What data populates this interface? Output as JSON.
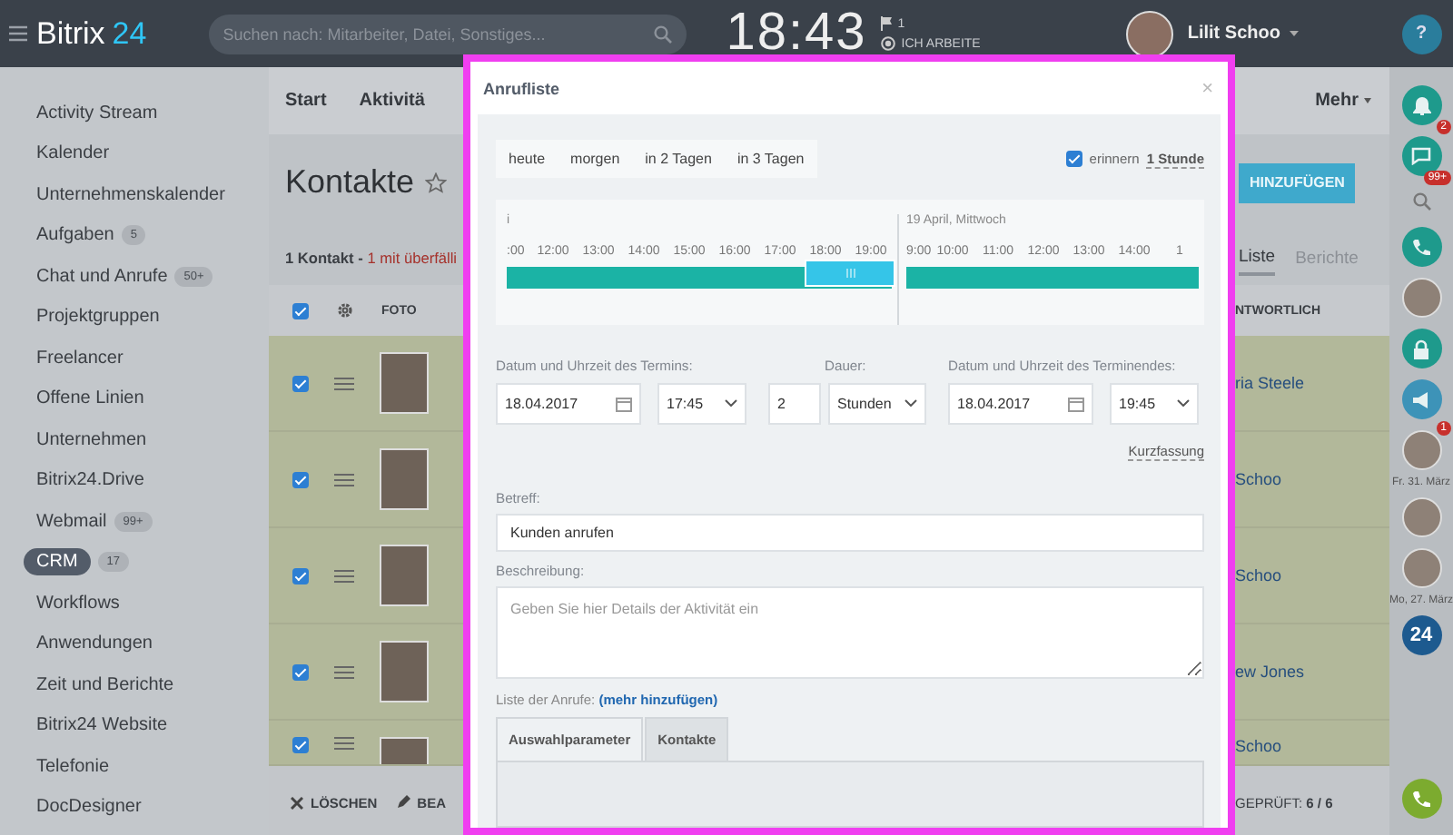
{
  "header": {
    "logo_name": "Bitrix",
    "logo_number": "24",
    "search": {
      "placeholder": "Suchen nach: Mitarbeiter, Datei, Sonstiges..."
    },
    "clock": "18:43",
    "flag_count": "1",
    "work_status": "ICH ARBEITE",
    "user_name": "Lilit Schoo"
  },
  "sidebar": {
    "items": [
      {
        "label": "Activity Stream",
        "selected": false
      },
      {
        "label": "Kalender",
        "selected": false
      },
      {
        "label": "Unternehmenskalender",
        "selected": false
      },
      {
        "label": "Aufgaben",
        "counter": "5",
        "selected": false
      },
      {
        "label": "Chat und Anrufe",
        "counter": "50+",
        "selected": false
      },
      {
        "label": "Projektgruppen",
        "selected": false
      },
      {
        "label": "Freelancer",
        "selected": false
      },
      {
        "label": "Offene Linien",
        "selected": false
      },
      {
        "label": "Unternehmen",
        "selected": false
      },
      {
        "label": "Bitrix24.Drive",
        "selected": false
      },
      {
        "label": "Webmail",
        "counter": "99+",
        "selected": false
      },
      {
        "label": "CRM",
        "counter": "17",
        "selected": true
      },
      {
        "label": "Workflows",
        "selected": false
      },
      {
        "label": "Anwendungen",
        "selected": false
      },
      {
        "label": "Zeit und Berichte",
        "selected": false
      },
      {
        "label": "Bitrix24 Website",
        "selected": false
      },
      {
        "label": "Telefonie",
        "selected": false
      },
      {
        "label": "DocDesigner",
        "selected": false
      }
    ]
  },
  "main": {
    "toolbar_tabs": [
      "Start",
      "Aktivitä"
    ],
    "more_menu": "Mehr",
    "title": "Kontakte",
    "add_button": "HINZUFÜGEN",
    "summary": "1 Kontakt - ",
    "overdue": "1 mit überfälli",
    "view_tabs": [
      {
        "label": "Liste",
        "selected": true
      },
      {
        "label": "Berichte",
        "selected": false
      }
    ],
    "select_all": {
      "checked": true
    },
    "columns": [
      "FOTO",
      "NTWORTLICH"
    ],
    "rows": [
      {
        "checked": true,
        "responsible": "ria Steele"
      },
      {
        "checked": true,
        "responsible": "Schoo"
      },
      {
        "checked": true,
        "responsible": "Schoo"
      },
      {
        "checked": true,
        "responsible": "ew Jones"
      },
      {
        "checked": true,
        "responsible": "Schoo"
      }
    ],
    "footer_actions": [
      "LÖSCHEN",
      "BEA"
    ],
    "checked_summary": "GEPRÜFT: ",
    "checked_count": "6 / 6"
  },
  "rail": {
    "items": [
      {
        "kind": "help",
        "text": "?"
      },
      {
        "kind": "bell",
        "badge": "2"
      },
      {
        "kind": "chat",
        "badge": "99+"
      },
      {
        "kind": "search"
      },
      {
        "kind": "phone"
      },
      {
        "kind": "avatar"
      },
      {
        "kind": "lock"
      },
      {
        "kind": "megaphone"
      },
      {
        "kind": "avatar",
        "badge": "1"
      },
      {
        "kind": "date",
        "text": "Fr. 31. März"
      },
      {
        "kind": "avatar"
      },
      {
        "kind": "avatar"
      },
      {
        "kind": "date",
        "text": "Mo, 27. März"
      },
      {
        "kind": "logo",
        "text": "24"
      },
      {
        "kind": "call"
      }
    ]
  },
  "dialog": {
    "title": "Anrufliste",
    "close": "×",
    "day_tabs": [
      "heute",
      "morgen",
      "in 2 Tagen",
      "in 3 Tagen"
    ],
    "reminder": {
      "checked": true,
      "label": "erinnern",
      "value": "1 Stunde"
    },
    "timeline": {
      "day_1": "i",
      "day_2": "19 April, Mittwoch",
      "hours_1": [
        ":00",
        "12:00",
        "13:00",
        "14:00",
        "15:00",
        "16:00",
        "17:00",
        "18:00",
        "19:00"
      ],
      "hours_2": [
        "9:00",
        "10:00",
        "11:00",
        "12:00",
        "13:00",
        "14:00",
        "1"
      ]
    },
    "start_label": "Datum und Uhrzeit des Termins:",
    "start_date": "18.04.2017",
    "start_time": "17:45",
    "duration_label": "Dauer:",
    "duration": "2",
    "duration_unit": "Stunden",
    "end_label": "Datum und Uhrzeit des Terminendes:",
    "end_date": "18.04.2017",
    "end_time": "19:45",
    "summary_link": "Kurzfassung",
    "subject_label": "Betreff:",
    "subject": "Kunden anrufen",
    "description_label": "Beschreibung:",
    "description": {
      "placeholder": "Geben Sie hier Details der Aktivität ein"
    },
    "call_list_label": "Liste der Anrufe:",
    "call_list_link": "(mehr hinzufügen)",
    "tabs": [
      {
        "label": "Auswahlparameter",
        "selected": true
      },
      {
        "label": "Kontakte",
        "selected": false
      }
    ]
  }
}
